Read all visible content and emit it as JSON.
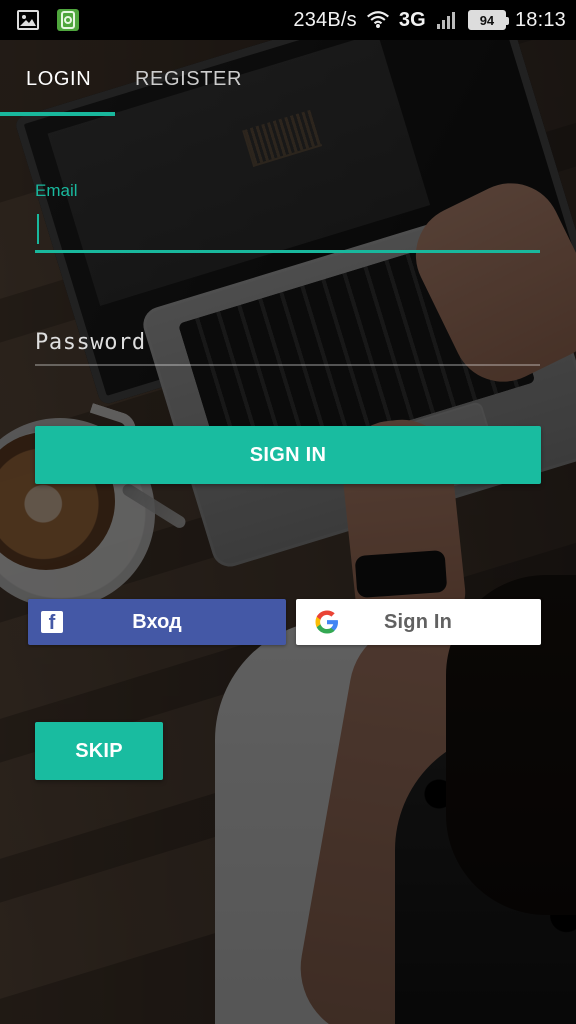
{
  "status_bar": {
    "speed": "234B/s",
    "network": "3G",
    "battery": "94",
    "time": "18:13",
    "icons": [
      "image-icon",
      "app-notification-icon",
      "wifi-icon",
      "signal-icon",
      "battery-icon"
    ]
  },
  "tabs": {
    "login": "LOGIN",
    "register": "REGISTER"
  },
  "form": {
    "email_label": "Email",
    "email_value": "",
    "password_placeholder": "Password",
    "password_value": "",
    "sign_in_button": "SIGN IN"
  },
  "social": {
    "facebook_label": "Вход",
    "google_label": "Sign In"
  },
  "actions": {
    "skip_button": "SKIP"
  },
  "colors": {
    "accent": "#19B89D",
    "facebook": "#4458A6",
    "google_button": "#FFFFFF"
  }
}
